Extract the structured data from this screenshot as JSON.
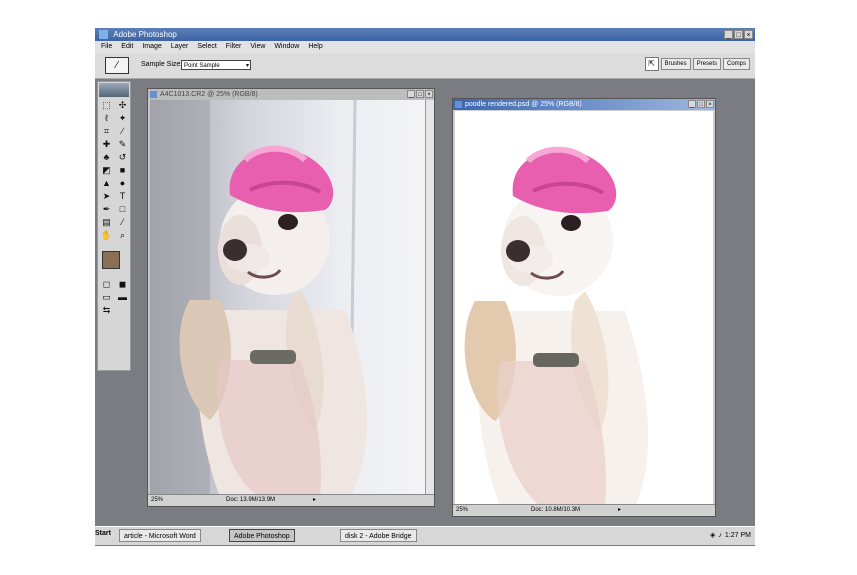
{
  "app": {
    "title": "Adobe Photoshop"
  },
  "menu": [
    "File",
    "Edit",
    "Image",
    "Layer",
    "Select",
    "Filter",
    "View",
    "Window",
    "Help"
  ],
  "options": {
    "sample_size_label": "Sample Size:",
    "sample_size_value": "Point Sample"
  },
  "palette_tabs": [
    "Brushes",
    "Presets",
    "Comps"
  ],
  "documents": [
    {
      "title": "A4C1013.CR2 @ 25% (RGB/8)",
      "zoom": "25%",
      "doc_size": "Doc: 13.9M/13.9M"
    },
    {
      "title": "poodle rendered.psd @ 25% (RGB/8)",
      "zoom": "25%",
      "doc_size": "Doc: 10.8M/10.3M"
    }
  ],
  "taskbar": {
    "start": "Start",
    "tasks": [
      "article - Microsoft Word",
      "Adobe Photoshop",
      "disk 2 - Adobe Bridge"
    ],
    "clock": "1:27 PM"
  },
  "colors": {
    "titlebar": "#3d63a5",
    "workspace": "#7b7b82",
    "foreground_swatch": "#8a6f55",
    "hat": "#e85fb0"
  },
  "icons": [
    "photoshop-icon",
    "eyedropper-icon",
    "marquee-icon",
    "lasso-icon",
    "crop-icon",
    "brush-icon",
    "stamp-icon",
    "eraser-icon",
    "gradient-icon",
    "pen-icon",
    "type-icon",
    "hand-icon",
    "zoom-icon"
  ]
}
